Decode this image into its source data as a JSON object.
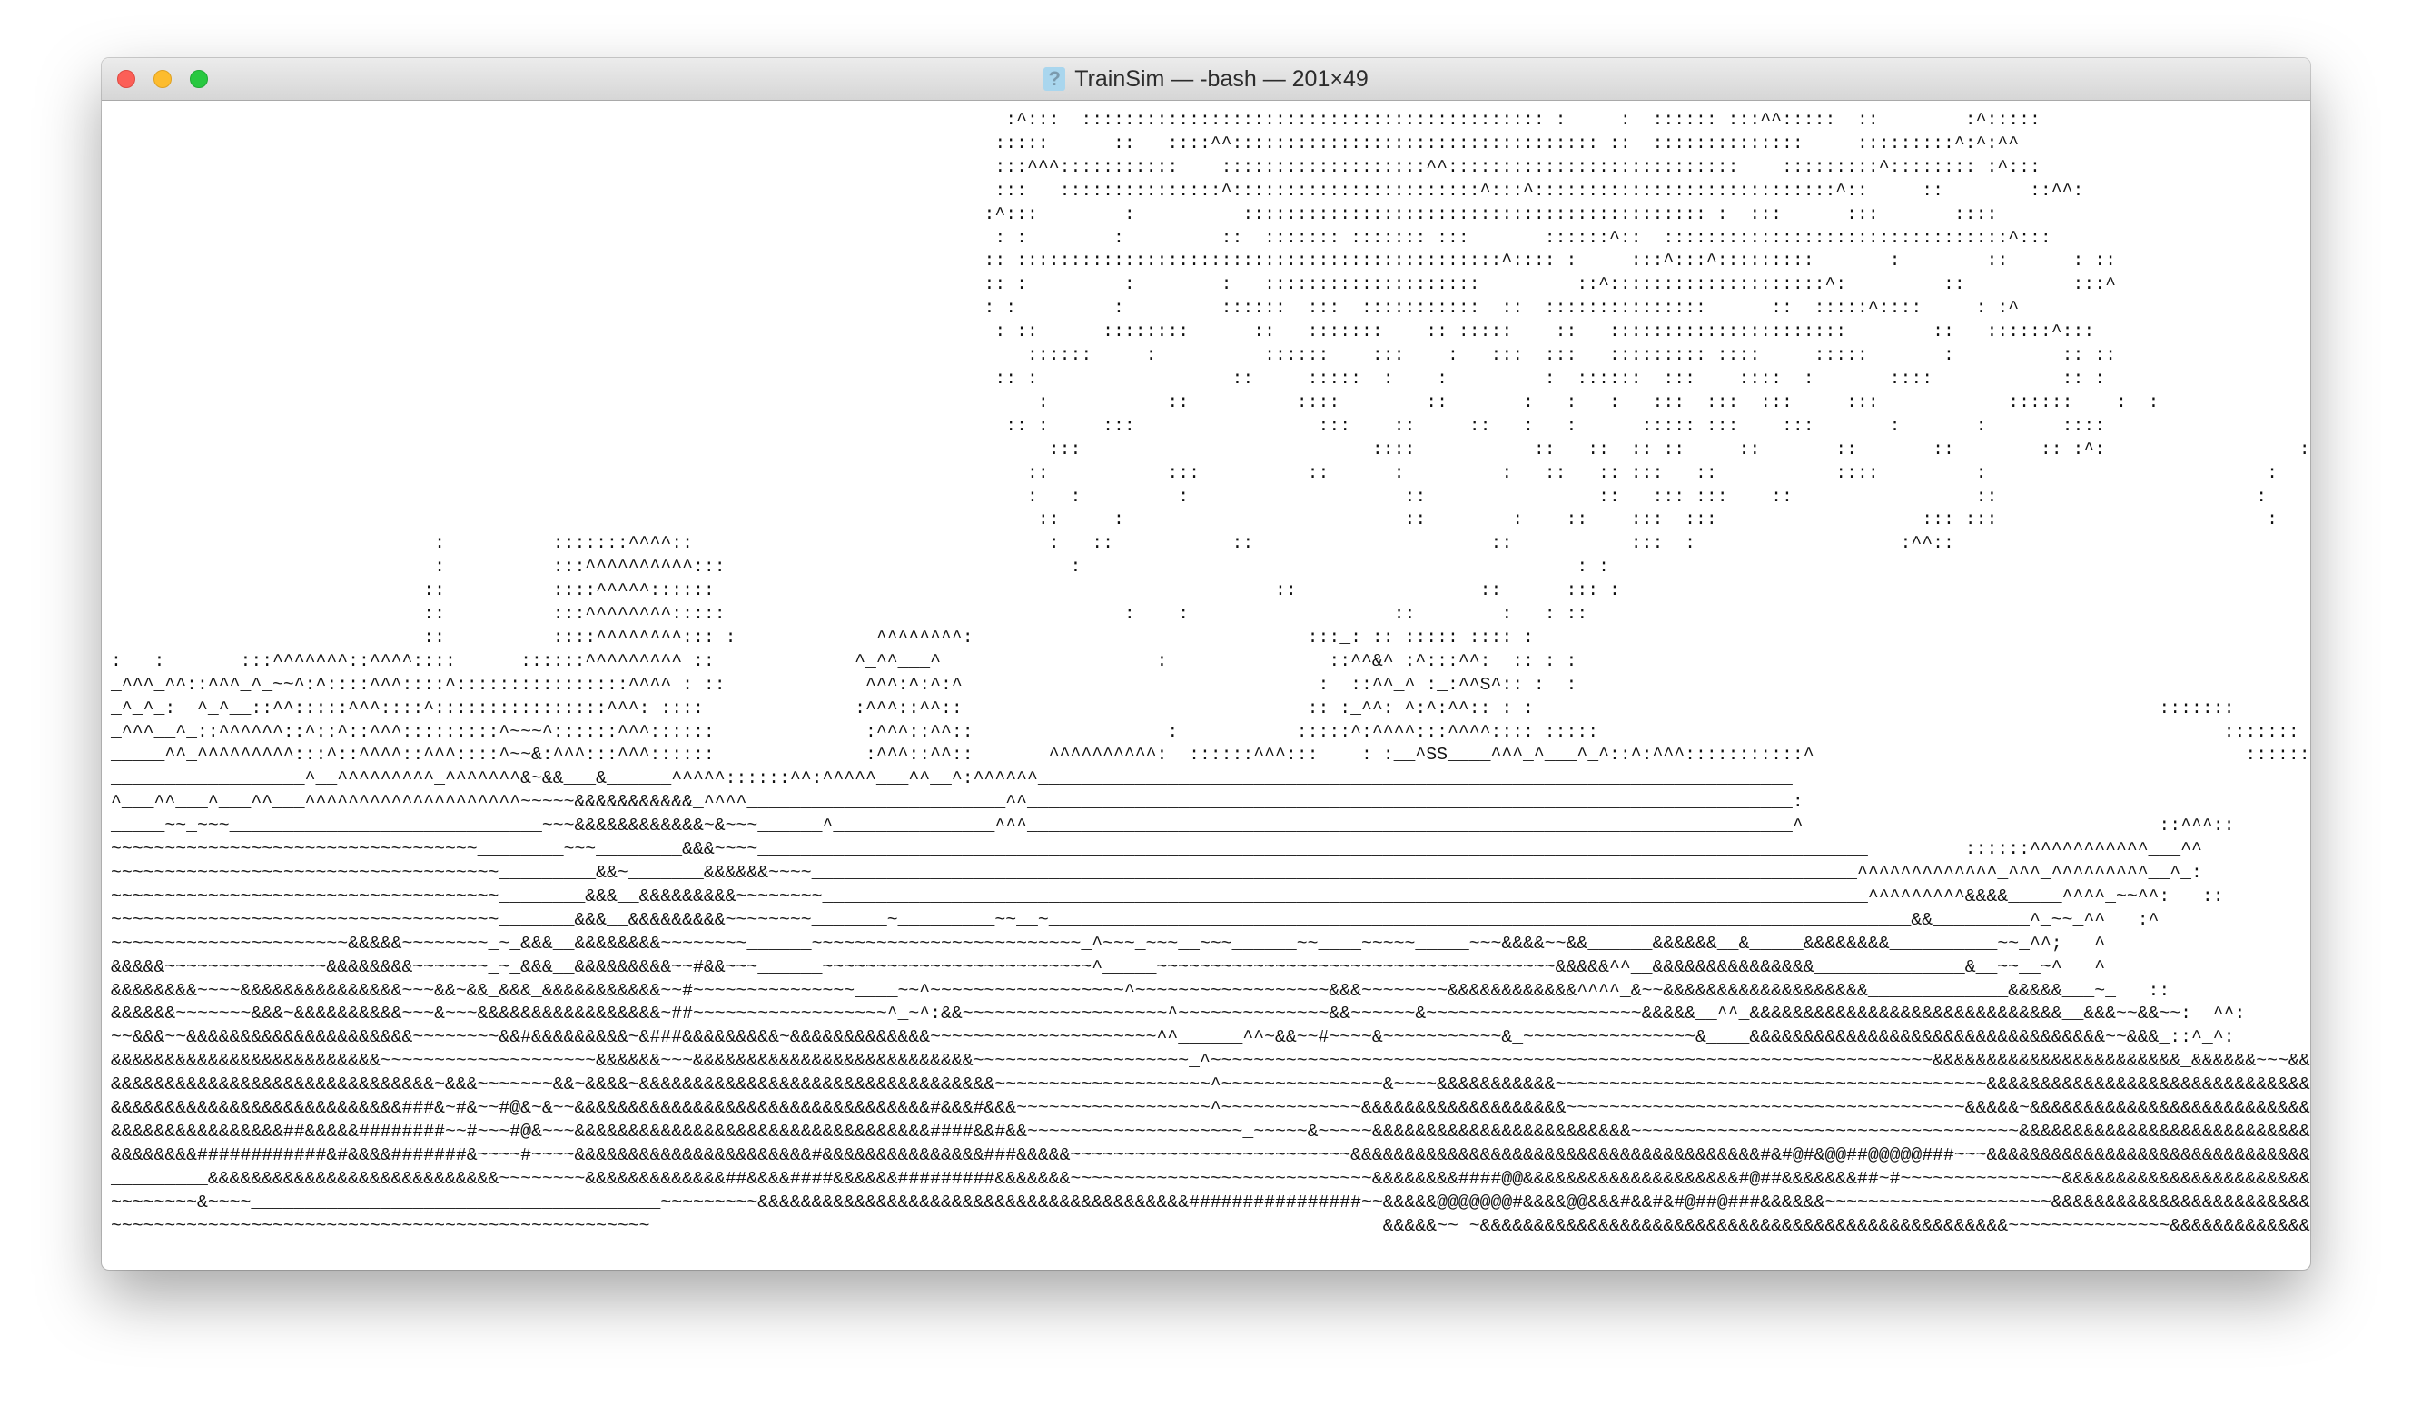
{
  "window": {
    "title": "TrainSim — -bash — 201×49",
    "title_icon": "question-document-icon"
  },
  "terminal": {
    "lines": [
      "                                                                                   :^:::  ::::::::::::::::::::::::::::::::::::::::::: :     :  :::::: :::^^:::::  ::        :^:::::",
      "                                                                                  :::::      ::   ::::^^:::::::::::::::::::::::::::::::::: ::  ::::::::::::::     :::::::::^:^:^^",
      "                                                                                  :::^^^:::::::::::    :::::::::::::::::::^^:::::::::::::::::::::::::::    :::::::::^:::::::: :^:::",
      "                                                                                  :::   :::::::::::::::^:::::::::::::::::::::::^:::^::::::::::::::::::::::::::::^::     ::        ::^^:",
      "                                                                                 :^:::        :          ::::::::::::::::::::::::::::::::::::::::::: :  :::      :::       ::::",
      "                                                                                  : :        :         ::  ::::::: ::::::: :::       ::::::^::  ::::::::::::::::::::::::::::::::^:::",
      "                                                                                 :: :::::::::::::::::::::::::::::::::::::::::::::^:::: :     :::^:::^:::::::::       :        ::      : ::",
      "                                                                                 :: :         :        :   ::::::::::::::::::::         ::^::::::::::::::::::::^:         ::          :::^",
      "                                                                                 : :         :         ::::::  :::  :::::::::::  ::  :::::::::::::::      ::  :::::^::::     : :^",
      "                                                                                  : ::      ::::::::      ::   :::::::    :: :::::    ::   ::::::::::::::::::::::        ::   ::::::^:::",
      "                                                                                     ::::::     :          ::::::    :::    :   :::  :::   ::::::::: ::::     :::::       :          :: ::                     :",
      "                                                                                  :: :                  ::     :::::  :    :         :  ::::::  :::    ::::  :       ::::            :: :                    ::",
      "                                                                                      :           ::          ::::        ::       :   :   :   :::  :::  :::     :::            ::::::    :  :                   :^",
      "                                                                                   :: :     :::                 :::    ::     ::   :   :      ::::: :::    :::       :       :       ::::                     ^",
      "                                                                                       :::                           ::::           ::   ::  :: ::     ::       ::       ::        :: :^:                  :",
      "                                                                                     ::           :::          ::      :         :   ::   :: :::   ::           ::::         :                          :",
      "                                                                                     :   :         :                    ::                ::   ::: :::    ::                 ::                        :",
      "                                                                                      ::     :                          ::        :    ::    :::  :::                   ::: :::                         :",
      "                              :          :::::::^^^^::                                 :   ::           ::                      ::           :::  :                   :^^::",
      "                              :          :::^^^^^^^^^^:::                                :                                              : :",
      "                             ::          ::::^^^^^::::::                                                    ::                 ::      ::: :",
      "                             ::          :::^^^^^^^^:::::                                     :    :                   ::        :   : ::",
      "                             ::          ::::^^^^^^^^::: :             ^^^^^^^^:                               :::_: :: ::::: :::: :",
      ":   :       :::^^^^^^^::^^^^::::      ::::::^^^^^^^^^ ::             ^_^^___^                    :               ::^^&^ :^:::^^:  :: : :",
      "_^^^_^^::^^^_^_~~^:^::::^^^::::^::::::::::::::::^^^^ : ::             ^^^:^:^:^                                 :  ::^^_^ :_:^^S^:: :  :",
      "_^_^_:  ^_^__::^^:::::^^^::::^::::::::::::::::^^^: ::::              :^^^::^^::                                :: :_^^: ^:^:^^:: : :                                                          :::::::",
      "_^^^__^_::^^^^^^::^::^::^^^:::::::::^~~~^::::::^^^::::::              :^^^::^^::                  :           :::::^:^^^^:::^^^^:::: :::::                                                          :::::::",
      "_____^^_^^^^^^^^^:::^::^^^^::^^^::::^~~&:^^^:::^^^::::::              :^^^::^^::       ^^^^^^^^^^:  ::::::^^^:::    : :__^SS____^^^_^___^_^::^:^^^:::::::::::^                                        :::::::",
      "__________________^__^^^^^^^^^_^^^^^^^&~&&___&______^^^^^::::::^^:^^^^^___^^__^:^^^^^^______________________________________________________________________",
      "^___^^___^___^^___^^^^^^^^^^^^^^^^^^^^~~~~~&&&&&&&&&&&_^^^^________________________^^_______________________________________________________________________:",
      "_____~~_~~~_____________________________~~~&&&&&&&&&&&&~&~~~______^_______________^^^_______________________________________________________________________^                                 ::^^^::",
      "~~~~~~~~~~~~~~~~~~~~~~~~~~~~~~~~~~________~~~________&&&~~~~_______________________________________________________________________________________________________         ::::::^^^^^^^^^^^___^^",
      "~~~~~~~~~~~~~~~~~~~~~~~~~~~~~~~~~~~~_________&&~_______&&&&&&~~~~_________________________________________________________________________________________________^^^^^^^^^^^^^_^^^_^^^^^^^^^__^_:",
      "~~~~~~~~~~~~~~~~~~~~~~~~~~~~~~~~~~~~________&&&__&&&&&&&&&~~~~~~~~_________________________________________________________________________________________________^^^^^^^^^&&&&_____^^^^_~~^^:   ::",
      "~~~~~~~~~~~~~~~~~~~~~~~~~~~~~~~~~~~~_______&&&__&&&&&&&&&~~~~~~~~_______~_________~~__~________________________________________________________________________________&&_________^_~~_^^   :^",
      "~~~~~~~~~~~~~~~~~~~~~~&&&&&~~~~~~~~_~_&&&__&&&&&&&&~~~~~~~~______~~~~~~~~~~~~~~~~~~~~~~~~~_^~~~_~~~__~~~______~~____~~~~~_____~~~&&&&~~&&______&&&&&&__&_____&&&&&&&&__________~~_^^;   ^",
      "&&&&&~~~~~~~~~~~~~~~&&&&&&&&~~~~~~~_~_&&&__&&&&&&&&&~~#&&~~~______~~~~~~~~~~~~~~~~~~~~~~~~~^_____~~~~~~~~~~~~~~~~~~~~~~~~~~~~~~~~~~~~~&&&&&^^__&&&&&&&&&&&&&&&______________&__~~__~^   ^",
      "&&&&&&&&~~~~&&&&&&&&&&&&&&&~~~&&~&&_&&&_&&&&&&&&&&&~~#~~~~~~~~~~~~~~~____~~^~~~~~~~~~~~~~~~~~~^~~~~~~~~~~~~~~~~~~&&&~~~~~~~~&&&&&&&&&&&&^^^^_&~~&&&&&&&&&&&&&&&&&&&_____________&&&&&___~_   ::",
      "&&&&&&~~~~~~~&&&~&&&&&&&&&&~~~&~~~&&&&&&&&&&&&&&&&&~##~~~~~~~~~~~~~~~~~~^_~^:&&~~~~~~~~~~~~~~~~~~~^~~~~~~~~~~~~~~&&~~~~~~&~~~~~~~~~~~~~~~~~~~~&&&&&__^^_&&&&&&&&&&&&&&&&&&&&&&&&&&&&&__&&&~~&&~~:  ^^:",
      "~~&&&~~&&&&&&&&&&&&&&&&&&&&&~~~~~~~~&&#&&&&&&&&&~&###&&&&&&&&&~&&&&&&&&&&&&&~~~~~~~~~~~~~~~~~~~~~^^______^^~&&~~#~~~~&~~~~~~~~~~~&_~~~~~~~~~~~~~~~~&____&&&&&&&&&&&&&&&&&&&&&&&&&&&&&&&&&~~&&&_::^_^:",
      "&&&&&&&&&&&&&&&&&&&&&&&&&~~~~~~~~~~~~~~~~~~~~&&&&&&~~~&&&&&&&&&&&&&&&&&&&&&&&&&&~~~~~~~~~~~~~~~~~~~~_^~~~~~~~~~~~~~~~~~~~~~~~~~~~~~~~~~~~~~~~~~~~~~~~~~~~~~~~~~~~~~~~~~~~&&&&&&&&&&&&&&&&&&&&&&&_&&&&&&~~~&&&___:",
      "&&&&&&&&&&&&&&&&&&&&&&&&&&&&&&~&&&~~~~~~~&&~&&&&~&&&&&&&&&&&&&&&&&&&&&&&&&&&&&&&&&~~~~~~~~~~~~~~~~~~~~^~~~~~~~~~~~~~~~&~~~~&&&&&&&&&&&~~~~~~~~~~~~~~~~~~~~~~~~~~~~~~~~~~~~~~~~&&&&&&&&&&&&&&&&&&&&&&&&&&&&&&&&~~~~~~~~_^::",
      "&&&&&&&&&&&&&&&&&&&&&&&&&&&###&~#&~~#@&~&~~&&&&&&&&&&&&&&&&&&&&&&&&&&&&&&&&&#&&&#&&&~~~~~~~~~~~~~~~~~~^~~~~~~~~~~~~~&&&&&&&&&&&&&&&&&&&~~~~~~~~~~~~~~~~~~~~~~~~~~~~~~~~~~~~~&&&&&~&&&&&&&&&&&&&&&&&&&&&&&&&&&&&&&&&&&&&~~~~~~",
      "&&&&&&&&&&&&&&&&##&&&&&########~~#~~~#@&~~~&&&&&&&&&&&&&&&&&&&&&&&&&&&&&&&&&####&&#&&~~~~~~~~~~~~~~~~~~~~_~~~~~&~~~~~&&&&&&&&&&&&&&&&&&&&&&&&~~~~~~~~~~~~~~~~~~~~~~~~~~~~~~~~~~~~&&&&&&&&&&&&&&&&&&&&&&&&&&&&&&&&&&&&&&&&&&&&~~~",
      "&&&&&&&&############&#&&&&#######&~~~~#~~~~&&&&&&&&&&&&&&&&&&&&&&#&&&&&&&&&&&&&&&###&&&&&~~~~~~~~~~~~~~~~~~~~~~~~~~&&&&&&&&&&&&&&&&&&&&&&&&&&&&&&&&&&&&&&#&#@#&@@##@@@@@###~~~&&&&&&&&&&&&&&&&&&&&&&&&&&&&&&&&&&&&&&&&&&&&&&&&&&",
      "_________&&&&&&&&&&&&&&&&&&&&&&&&&&&~~~~~~~~&&&&&&&&&&&&&##&&&&####&&&&&&#########&&&&&&&~~~~~~~~~~~~~~~~~~~~~~~~~~~~&&&&&&&&####@@&&&&&&&&&&&&&&&&&&&&#@##&&&&&&&##~#~~~~~~~~~~~~~~~&&&&&&&&&&&&&&&&&&&&&&&&&&&&&&&&&&&&&&&&&&&&&&",
      "~~~~~~~~&~~~~______________________________________~~~~~~~~~&&&&&&&&&&&&&&&&&&&&&&&&&&&&&&&&&&&&&&&&################~~&&&&&@@@@@@@#&&&&@@&&&#&&#&#@##@###&&&&&&~~~~~~~~~~~~~~~~~~~~~&&&&&&&&&&&&&&&&&&&&&&&&&&&&&&&&&&&&&&&&&&&&&&&",
      "~~~~~~~~~~~~~~~~~~~~~~~~~~~~~~~~~~~~~~~~~~~~~~~~~~____________________________________________________________________&&&&&~~_~&&&&&&&&&&&&&&&&&&&&&&&&&&&&&&&&&&&&&&&&&&&&&&&&&~~~~~~~~~~~~~~~&&&&&&&&&&&&&&&&&&&&&&&&&&&&&&&&&&&&&&&&&&&&&&&&"
    ]
  }
}
